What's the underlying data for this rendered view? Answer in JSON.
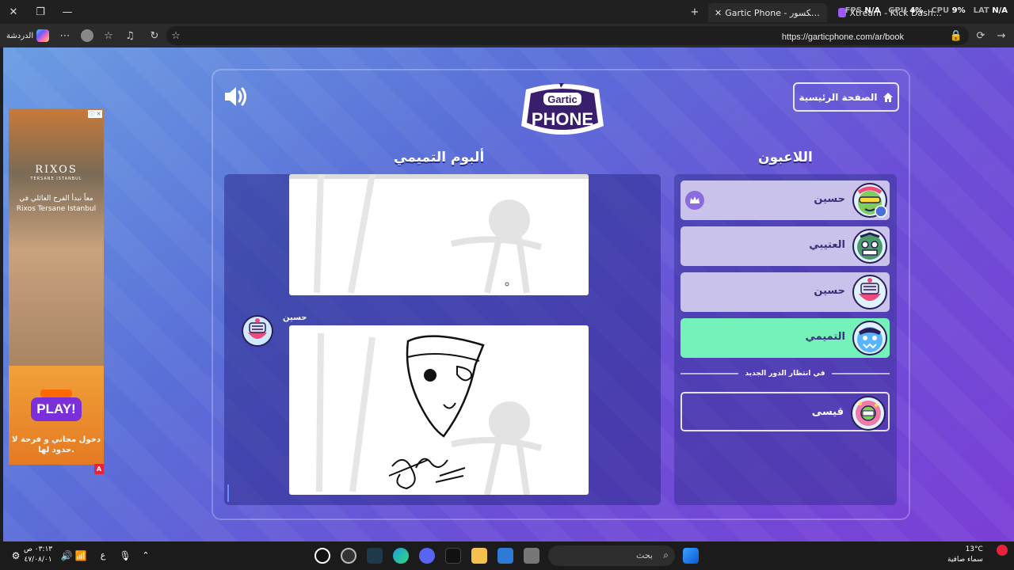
{
  "browser": {
    "tab_active_title": "Gartic Phone - لعبة الهاتف المكسور",
    "tab_other_title": "Xtream - Kick Dashboard",
    "url": "https://garticphone.com/ar/book",
    "chat_label": "الدردشة",
    "overlay": {
      "fps_label": "FPS",
      "fps": "N/A",
      "gpu_label": "GPU",
      "gpu": "4%",
      "cpu_label": "CPU",
      "cpu": "9%",
      "lat_label": "LAT",
      "lat": "N/A"
    }
  },
  "ad": {
    "brand": "RIXOS",
    "brand_sub": "TERSANE ISTANBUL",
    "headline": "معاً نبدأ الفرح العائلي في Rixos Tersane Istanbul",
    "play_label": "PLAY!",
    "bottom_text": "دخول مجاني و فرحة لا حدود لها.",
    "badge": "A"
  },
  "game": {
    "home_label": "الصفحة الرئيسية",
    "logo_top": "Gartic",
    "logo_bottom": "PHONE",
    "album_title": "ألبوم التميمي",
    "players_title": "اللاعبون",
    "entry_author": "حسين",
    "players": [
      {
        "name": "حسين",
        "host": true,
        "color": "#c9c2ea"
      },
      {
        "name": "العتيبي",
        "host": false,
        "color": "#c9c2ea"
      },
      {
        "name": "حسين",
        "host": false,
        "color": "#c9c2ea"
      },
      {
        "name": "التميمي",
        "host": false,
        "color": "#74f2b9"
      }
    ],
    "waiting_label": "في انتظار الدور الجديد",
    "waiting_players": [
      {
        "name": "قيسى"
      }
    ]
  },
  "taskbar": {
    "search_placeholder": "بحث",
    "time": "٠٣:١٣ ص",
    "date": "٤٧/٠٨/٠١",
    "lang": "ع",
    "temp": "13°C",
    "weather": "سماء صافية"
  }
}
